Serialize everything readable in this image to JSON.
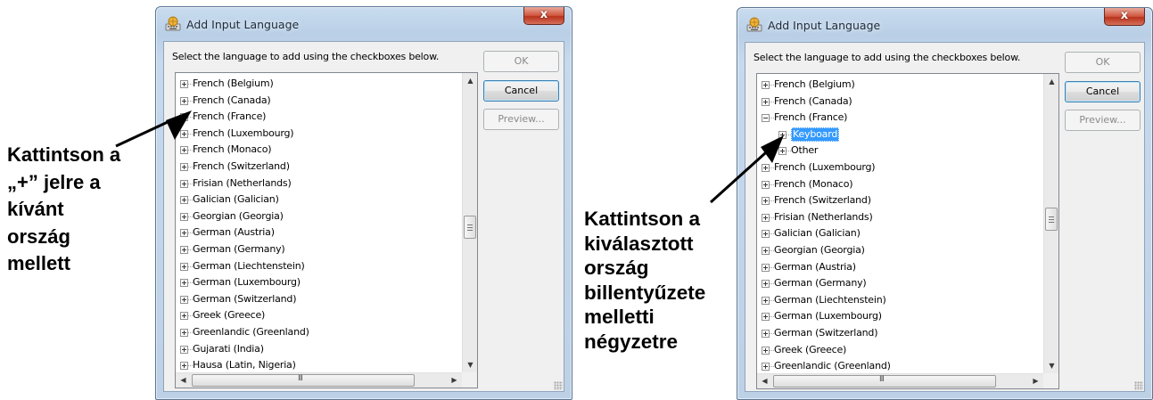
{
  "callout_left": {
    "lines": [
      "Kattintson a",
      "„+” jelre a",
      "kívánt",
      "ország",
      "mellett"
    ]
  },
  "callout_right": {
    "lines": [
      "Kattintson a",
      "kiválasztott",
      "ország",
      "billentyűzete",
      "melletti",
      "négyzetre"
    ]
  },
  "dialog_left": {
    "title": "Add Input Language",
    "close_label": "x",
    "instruction": "Select the language to add using the checkboxes below.",
    "buttons": {
      "ok": "OK",
      "cancel": "Cancel",
      "preview": "Preview..."
    },
    "tree": [
      "French (Belgium)",
      "French (Canada)",
      "French (France)",
      "French (Luxembourg)",
      "French (Monaco)",
      "French (Switzerland)",
      "Frisian (Netherlands)",
      "Galician (Galician)",
      "Georgian (Georgia)",
      "German (Austria)",
      "German (Germany)",
      "German (Liechtenstein)",
      "German (Luxembourg)",
      "German (Switzerland)",
      "Greek (Greece)",
      "Greenlandic (Greenland)",
      "Gujarati (India)",
      "Hausa (Latin, Nigeria)"
    ],
    "hscroll_grip": "III"
  },
  "dialog_right": {
    "title": "Add Input Language",
    "close_label": "x",
    "instruction": "Select the language to add using the checkboxes below.",
    "buttons": {
      "ok": "OK",
      "cancel": "Cancel",
      "preview": "Preview..."
    },
    "tree": [
      "French (Belgium)",
      "French (Canada)",
      "French (France)",
      "Keyboard",
      "Other",
      "French (Luxembourg)",
      "French (Monaco)",
      "French (Switzerland)",
      "Frisian (Netherlands)",
      "Galician (Galician)",
      "Georgian (Georgia)",
      "German (Austria)",
      "German (Germany)",
      "German (Liechtenstein)",
      "German (Luxembourg)",
      "German (Switzerland)",
      "Greek (Greece)",
      "Greenlandic (Greenland)"
    ],
    "selected_item": "Keyboard",
    "hscroll_grip": "III"
  },
  "colors": {
    "selection": "#3399ff",
    "window_frame": "#b9cfe6",
    "close_button": "#c7422c"
  },
  "icons": [
    "keyboard-globe-icon",
    "close-icon",
    "expand-plus-icon",
    "collapse-minus-icon",
    "scroll-up-arrow-icon",
    "scroll-down-arrow-icon",
    "scroll-left-arrow-icon",
    "scroll-right-arrow-icon"
  ]
}
